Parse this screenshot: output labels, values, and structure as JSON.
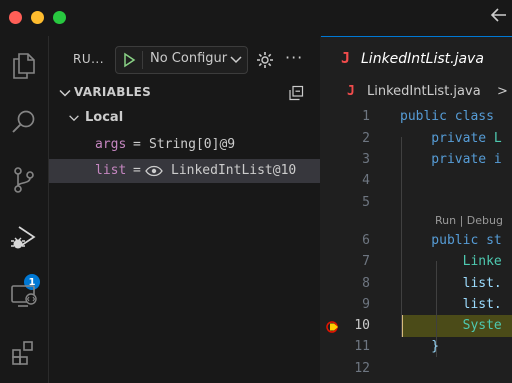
{
  "colors": {
    "close": "#ff5f57",
    "minimize": "#febc2e",
    "zoom": "#28c840",
    "accent": "#0078d4",
    "java": "#f14c4c",
    "keyword": "#569cd6",
    "type": "#4ec9b0",
    "variable": "#9cdcfe"
  },
  "titlebar": {
    "back_icon": "arrow-left-icon"
  },
  "activity_bar": {
    "items": [
      {
        "icon": "files-icon"
      },
      {
        "icon": "search-icon"
      },
      {
        "icon": "source-control-icon"
      },
      {
        "icon": "run-debug-icon",
        "badge": "1"
      },
      {
        "icon": "remote-explorer-icon"
      },
      {
        "icon": "extensions-icon"
      }
    ]
  },
  "sidebar": {
    "run_label": "RU...",
    "launch_config": "No Configuration",
    "variables_title": "VARIABLES",
    "scope": "Local",
    "variables": [
      {
        "name": "args",
        "equals": "=",
        "value": "String[0]@9"
      },
      {
        "name": "list",
        "equals": "=",
        "value": "LinkedIntList@10"
      }
    ]
  },
  "editor": {
    "tab_icon": "J",
    "tab_label": "LinkedIntList.java",
    "breadcrumb_icon": "J",
    "breadcrumb_file": "LinkedIntList.java",
    "breadcrumb_sep": ">",
    "codelens": "Run | Debug",
    "lines": [
      {
        "n": "1",
        "tokens": [
          [
            "kw",
            "public class "
          ]
        ]
      },
      {
        "n": "2",
        "tokens": [
          [
            "kw",
            "    private "
          ],
          [
            "ty",
            "L"
          ]
        ]
      },
      {
        "n": "3",
        "tokens": [
          [
            "kw",
            "    private "
          ],
          [
            "kw",
            "i"
          ]
        ]
      },
      {
        "n": "4",
        "tokens": []
      },
      {
        "n": "5",
        "tokens": []
      },
      {
        "n": "6",
        "tokens": [
          [
            "kw",
            "    public st"
          ]
        ]
      },
      {
        "n": "7",
        "tokens": [
          [
            "ty",
            "        Linke"
          ]
        ]
      },
      {
        "n": "8",
        "tokens": [
          [
            "id",
            "        list."
          ]
        ]
      },
      {
        "n": "9",
        "tokens": [
          [
            "id",
            "        list."
          ]
        ]
      },
      {
        "n": "10",
        "tokens": [
          [
            "ty",
            "        Syste"
          ]
        ]
      },
      {
        "n": "11",
        "tokens": [
          [
            "id",
            "    }"
          ]
        ]
      },
      {
        "n": "12",
        "tokens": []
      }
    ],
    "current_line": "10"
  }
}
